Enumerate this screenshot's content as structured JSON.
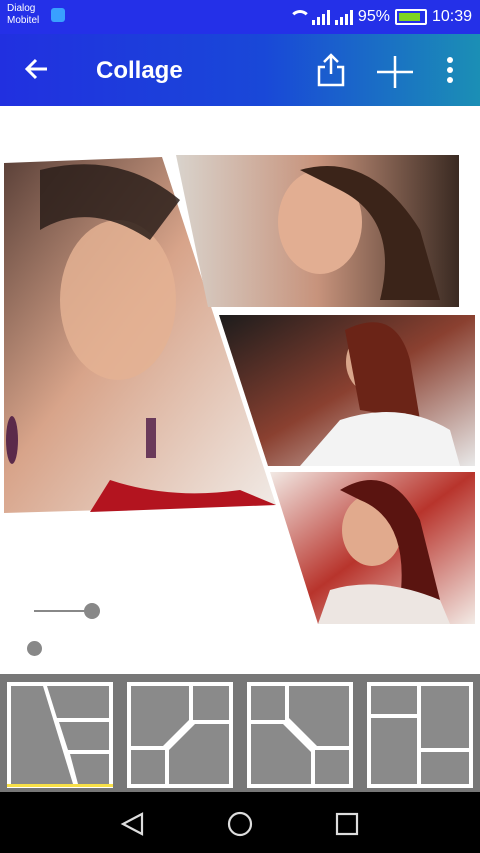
{
  "status_bar": {
    "carrier_line1": "Dialog",
    "carrier_line2": "Mobitel",
    "battery": "95%",
    "time": "10:39"
  },
  "app_bar": {
    "title": "Collage",
    "icons": [
      "back-arrow-icon",
      "share-icon",
      "add-icon",
      "more-vert-icon"
    ]
  },
  "layouts": [
    "slanted-split",
    "corner-polygons",
    "reverse-corner-polygons",
    "grid-mixed"
  ],
  "selected_layout_index": 0,
  "colors": {
    "status_bar": "#2430e8",
    "app_bar_start": "#2130e0",
    "app_bar_end": "#1b8fb5",
    "picker_bg": "#777777",
    "selection_indicator": "#f8e048"
  }
}
